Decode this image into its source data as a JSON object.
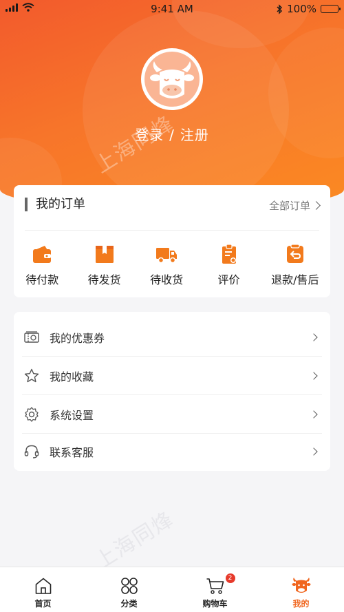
{
  "status_bar": {
    "time": "9:41 AM",
    "battery": "100%"
  },
  "profile": {
    "login": "登录",
    "separator": "/",
    "register": "注册"
  },
  "watermark": "上海同烽",
  "orders": {
    "title": "我的订单",
    "all_link": "全部订单",
    "items": [
      {
        "label": "待付款",
        "icon": "wallet-icon"
      },
      {
        "label": "待发货",
        "icon": "package-icon"
      },
      {
        "label": "待收货",
        "icon": "truck-icon"
      },
      {
        "label": "评价",
        "icon": "review-icon"
      },
      {
        "label": "退款/售后",
        "icon": "refund-icon"
      }
    ]
  },
  "menu": [
    {
      "label": "我的优惠券",
      "icon": "coupon-icon"
    },
    {
      "label": "我的收藏",
      "icon": "star-icon"
    },
    {
      "label": "系统设置",
      "icon": "settings-icon"
    },
    {
      "label": "联系客服",
      "icon": "headset-icon"
    }
  ],
  "tabbar": [
    {
      "label": "首页",
      "icon": "home-icon"
    },
    {
      "label": "分类",
      "icon": "category-icon"
    },
    {
      "label": "购物车",
      "icon": "cart-icon",
      "badge": "2"
    },
    {
      "label": "我的",
      "icon": "profile-icon",
      "active": true
    }
  ],
  "colors": {
    "accent": "#f0661f",
    "hero_start": "#f25a2c",
    "hero_end": "#fb8a22",
    "badge": "#e63a2b"
  }
}
